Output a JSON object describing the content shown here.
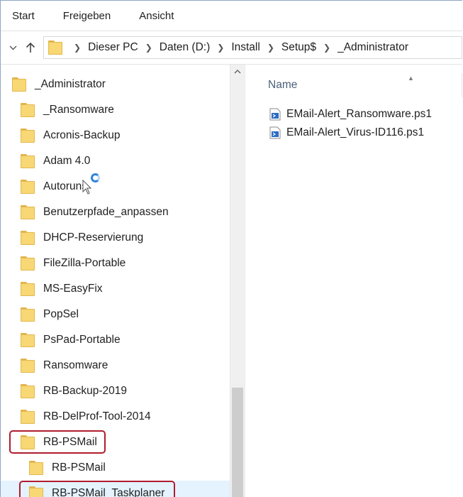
{
  "ribbon": {
    "tabs": [
      "Start",
      "Freigeben",
      "Ansicht"
    ]
  },
  "address": {
    "crumbs": [
      "Dieser PC",
      "Daten (D:)",
      "Install",
      "Setup$",
      "_Administrator"
    ]
  },
  "tree": {
    "items": [
      {
        "label": "_Administrator",
        "level": 0
      },
      {
        "label": "_Ransomware",
        "level": 1
      },
      {
        "label": "Acronis-Backup",
        "level": 1
      },
      {
        "label": "Adam 4.0",
        "level": 1
      },
      {
        "label": "Autoruns",
        "level": 1
      },
      {
        "label": "Benutzerpfade_anpassen",
        "level": 1
      },
      {
        "label": "DHCP-Reservierung",
        "level": 1
      },
      {
        "label": "FileZilla-Portable",
        "level": 1
      },
      {
        "label": "MS-EasyFix",
        "level": 1
      },
      {
        "label": "PopSel",
        "level": 1
      },
      {
        "label": "PsPad-Portable",
        "level": 1
      },
      {
        "label": "Ransomware",
        "level": 1
      },
      {
        "label": "RB-Backup-2019",
        "level": 1
      },
      {
        "label": "RB-DelProf-Tool-2014",
        "level": 1
      },
      {
        "label": "RB-PSMail",
        "level": 1,
        "highlighted": true
      },
      {
        "label": "RB-PSMail",
        "level": 2
      },
      {
        "label": "RB-PSMail_Taskplaner",
        "level": 2,
        "selected": true,
        "highlighted": true
      }
    ]
  },
  "files": {
    "column_name": "Name",
    "items": [
      {
        "name": "EMail-Alert_Ransomware.ps1",
        "icon": "powershell-script-icon"
      },
      {
        "name": "EMail-Alert_Virus-ID116.ps1",
        "icon": "powershell-script-icon"
      }
    ]
  },
  "colors": {
    "folder": "#f8d775",
    "highlight": "#b01c2e",
    "selection": "#e5f3ff"
  }
}
